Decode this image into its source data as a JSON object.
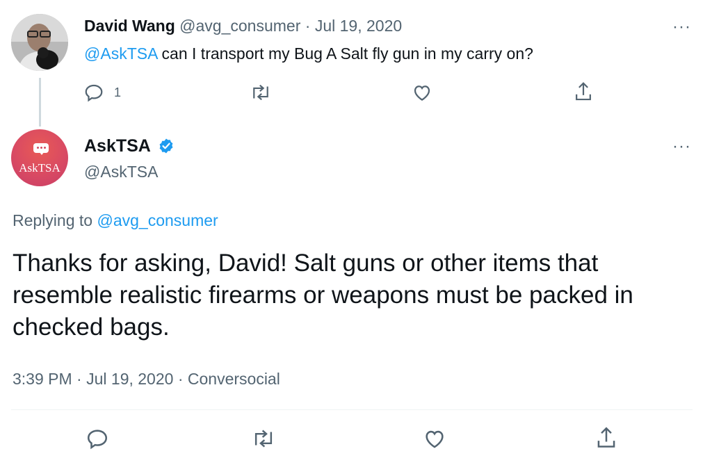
{
  "tweet1": {
    "author_name": "David Wang",
    "handle": "@avg_consumer",
    "separator": "·",
    "date": "Jul 19, 2020",
    "mention": "@AskTSA",
    "text": " can I transport my Bug A Salt fly gun in my carry on?",
    "reply_count": "1",
    "more_label": "···"
  },
  "tweet2": {
    "author_name": "AskTSA",
    "handle": "@AskTSA",
    "avatar_text": "AskTSA",
    "more_label": "···",
    "replying_prefix": "Replying to ",
    "replying_to": "@avg_consumer",
    "text": "Thanks for asking, David! Salt guns or other items that resemble realistic firearms or weapons must be packed in checked bags.",
    "time": "3:39 PM",
    "date": "Jul 19, 2020",
    "source": "Conversocial",
    "separator": "·"
  },
  "colors": {
    "link": "#1d9bf0",
    "muted": "#536471",
    "verified": "#1d9bf0",
    "avatar_tsa": "#d94a63"
  },
  "icons": [
    "reply-icon",
    "retweet-icon",
    "like-icon",
    "share-icon",
    "verified-badge-icon",
    "more-icon"
  ]
}
